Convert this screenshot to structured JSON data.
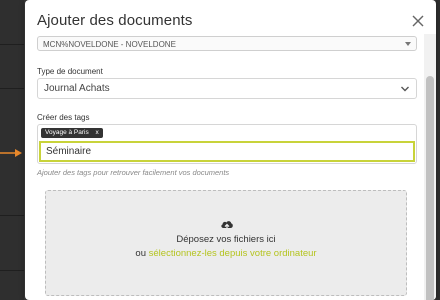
{
  "modal": {
    "title": "Ajouter des documents"
  },
  "account_select": {
    "value": "MCN%NOVELDONE - NOVELDONE"
  },
  "document_type": {
    "label": "Type de document",
    "value": "Journal Achats"
  },
  "tags": {
    "label": "Créer des tags",
    "chips": [
      "Voyage à Paris"
    ],
    "chip_remove": "x",
    "input_value": "Séminaire",
    "helper": "Ajouter des tags pour retrouver facilement vos documents"
  },
  "dropzone": {
    "title": "Déposez vos fichiers ici",
    "prefix": "ou",
    "link": "sélectionnez-les depuis votre ordinateur"
  },
  "icons": {
    "close": "close-icon",
    "chevron": "chevron-down-icon",
    "upload": "cloud-upload-icon",
    "callout": "arrow-right-icon"
  },
  "colors": {
    "accent": "#c8d33a",
    "link": "#b5c420",
    "callout": "#e8882b",
    "chip_bg": "#333333"
  }
}
